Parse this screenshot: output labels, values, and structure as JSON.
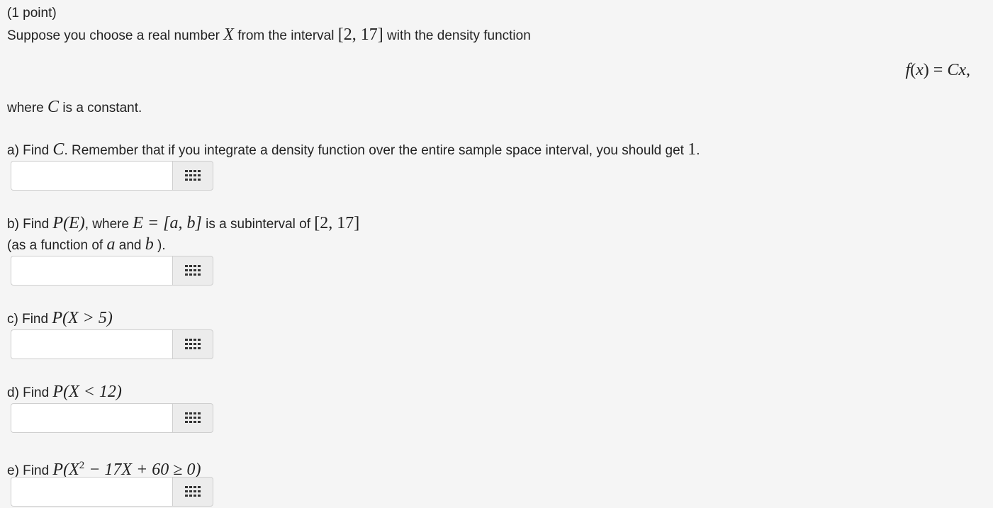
{
  "header": {
    "points": "(1 point)"
  },
  "intro": {
    "prefix": "Suppose you choose a real number",
    "var_X": "X",
    "mid": "from the interval",
    "interval": "[2, 17]",
    "suffix": "with the density function"
  },
  "formula": {
    "lhs": "f(x)",
    "eq": " = ",
    "rhs": "Cx,",
    "f": "f",
    "x": "x",
    "C": "C"
  },
  "where_line": {
    "prefix": "where",
    "C": "C",
    "suffix": "is a constant."
  },
  "parts": {
    "a": {
      "prefix": "a) Find",
      "C": "C",
      "suffix": ". Remember that if you integrate a density function over the entire sample space interval, you should get",
      "one": "1",
      "period": ".",
      "answer_value": ""
    },
    "b": {
      "prefix": "b) Find",
      "PE": "P(E)",
      "mid": ", where",
      "E_def": "E = [a, b]",
      "mid2": "is a subinterval of",
      "interval": "[2, 17]",
      "line2_prefix": "(as a function of",
      "a": "a",
      "and": "and",
      "b": "b",
      "line2_suffix": ")."
    },
    "c": {
      "prefix": "c) Find",
      "expr": "P(X > 5)"
    },
    "d": {
      "prefix": "d) Find",
      "expr": "P(X < 12)"
    },
    "e": {
      "prefix": "e) Find",
      "expr_pre": "P(X",
      "exp": "2",
      "expr_post": " − 17X + 60 ≥ 0)"
    }
  },
  "icons": {
    "palette": "grid-icon"
  }
}
